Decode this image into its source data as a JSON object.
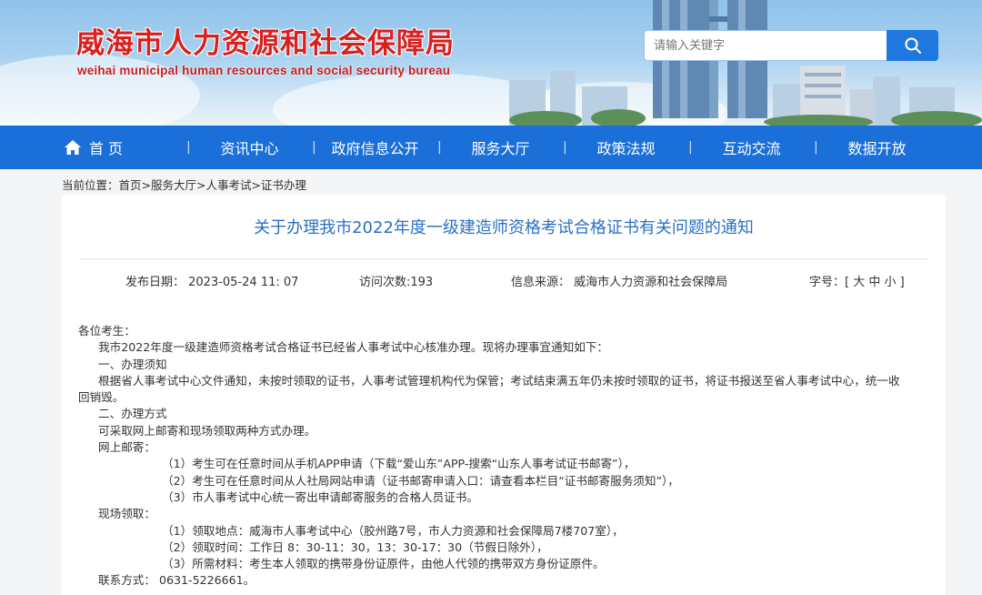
{
  "header": {
    "title": "威海市人力资源和社会保障局",
    "subtitle": "weihai municipal human resources and social security bureau",
    "search_placeholder": "请输入关键字"
  },
  "nav": {
    "items": [
      "首 页",
      "资讯中心",
      "政府信息公开",
      "服务大厅",
      "政策法规",
      "互动交流",
      "数据开放"
    ],
    "separator": "|"
  },
  "breadcrumb": {
    "prefix": "当前位置：",
    "path": "首页>服务大厅>人事考试>证书办理"
  },
  "article": {
    "title": "关于办理我市2022年度一级建造师资格考试合格证书有关问题的通知",
    "meta": {
      "date": "发布日期： 2023-05-24 11: 07",
      "visits": "访问次数:193",
      "source": "信息来源： 威海市人力资源和社会保障局",
      "font_label": "字号：",
      "font_sizes": "[ 大 中 小 ]"
    },
    "lines": [
      "各位考生：",
      "我市2022年度一级建造师资格考试合格证书已经省人事考试中心核准办理。现将办理事宜通知如下：",
      "一、办理须知",
      "根据省人事考试中心文件通知，未按时领取的证书，人事考试管理机构代为保管；考试结束满五年仍未按时领取的证书，将证书报送至省人事考试中心，统一收",
      "回销毁。",
      "二、办理方式",
      "可采取网上邮寄和现场领取两种方式办理。",
      "网上邮寄：",
      "（1）考生可在任意时间从手机APP申请（下载“爱山东”APP-搜索“山东人事考试证书邮寄”），",
      "（2）考生可在任意时间从人社局网站申请（证书邮寄申请入口：请查看本栏目“证书邮寄服务须知”），",
      "（3）市人事考试中心统一寄出申请邮寄服务的合格人员证书。",
      "现场领取：",
      "（1）领取地点：威海市人事考试中心（胶州路7号，市人力资源和社会保障局7楼707室），",
      "（2）领取时间：工作日 8：30-11：30，13：30-17：30（节假日除外），",
      "（3）所需材料：考生本人领取的携带身份证原件，由他人代领的携带双方身份证原件。",
      "联系方式： 0631-5226661。"
    ]
  },
  "colors": {
    "brand_red": "#d8211f",
    "nav_blue": "#1b6fd8",
    "title_blue": "#2a6fc4"
  },
  "icons": [
    "search-icon",
    "home-icon"
  ]
}
